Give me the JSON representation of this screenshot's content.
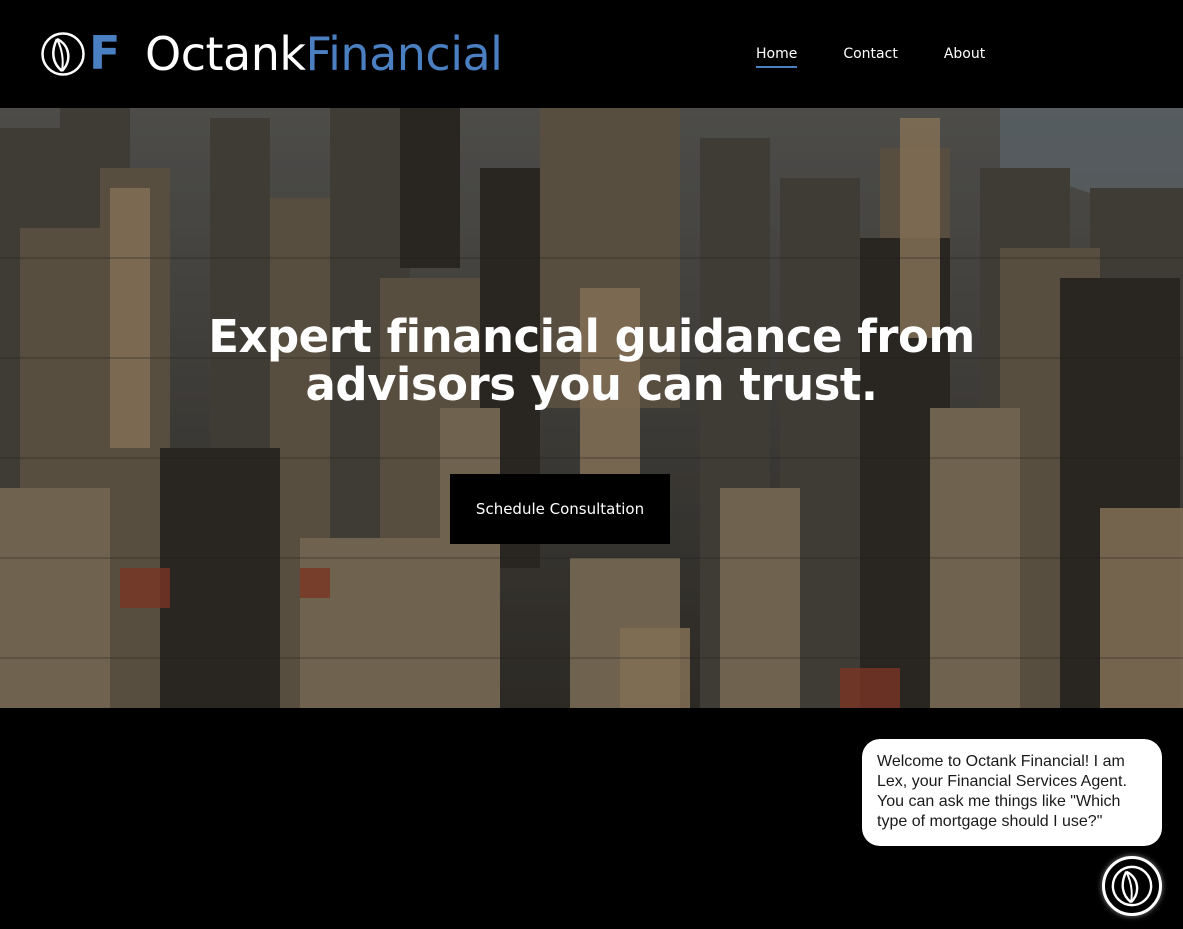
{
  "header": {
    "logo_letter": "F",
    "brand_part1": "Octank",
    "brand_part2": "Financial",
    "nav": [
      {
        "label": "Home",
        "active": true
      },
      {
        "label": "Contact",
        "active": false
      },
      {
        "label": "About",
        "active": false
      }
    ]
  },
  "hero": {
    "title_line1": "Expert financial guidance from",
    "title_line2": "advisors you can trust.",
    "cta_label": "Schedule Consultation",
    "background": "city-skyline-photo"
  },
  "chat": {
    "welcome_message": "Welcome to Octank Financial! I am Lex, your Financial Services Agent. You can ask me things like \"Which type of mortgage should I use?\"",
    "launcher_icon": "octank-leaf-icon"
  },
  "colors": {
    "accent": "#4a7fc1",
    "background": "#000000",
    "bubble": "#ffffff"
  }
}
